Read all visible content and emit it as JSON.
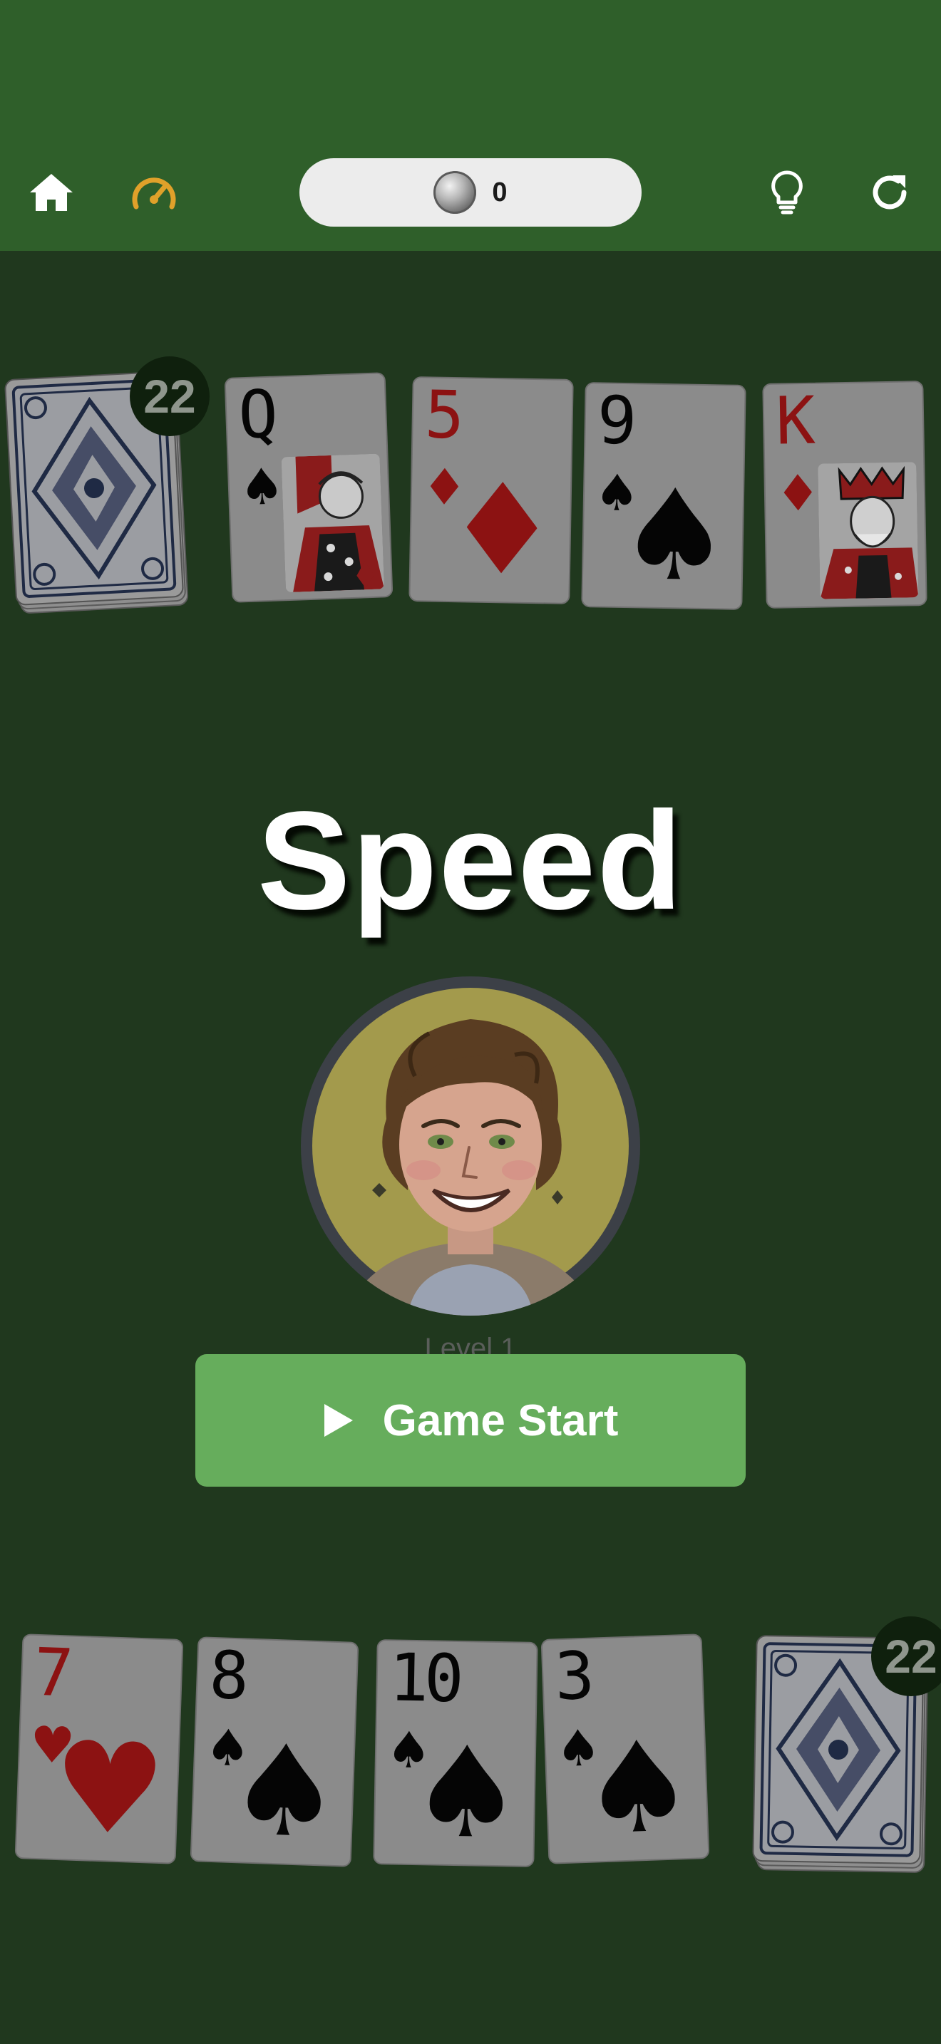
{
  "header": {
    "coin_count": "0",
    "colors": {
      "bar": "#2f5f2a",
      "accent": "#e0a12a",
      "icon": "#ffffff"
    },
    "icons": [
      "home-icon",
      "speedometer-icon",
      "coin-icon",
      "lightbulb-icon",
      "refresh-icon"
    ]
  },
  "opponent": {
    "deck_count": "22",
    "cards": [
      {
        "rank": "Q",
        "suit": "♠",
        "color": "black",
        "face": "queen"
      },
      {
        "rank": "5",
        "suit": "♦",
        "color": "red"
      },
      {
        "rank": "9",
        "suit": "♠",
        "color": "black"
      },
      {
        "rank": "K",
        "suit": "♦",
        "color": "red",
        "face": "king"
      }
    ]
  },
  "overlay": {
    "title": "Speed",
    "level": "Level 1",
    "start_label": "Game Start"
  },
  "player": {
    "deck_count": "22",
    "cards": [
      {
        "rank": "7",
        "suit": "♥",
        "color": "red"
      },
      {
        "rank": "8",
        "suit": "♠",
        "color": "black"
      },
      {
        "rank": "10",
        "suit": "♠",
        "color": "black"
      },
      {
        "rank": "3",
        "suit": "♠",
        "color": "black"
      }
    ]
  }
}
